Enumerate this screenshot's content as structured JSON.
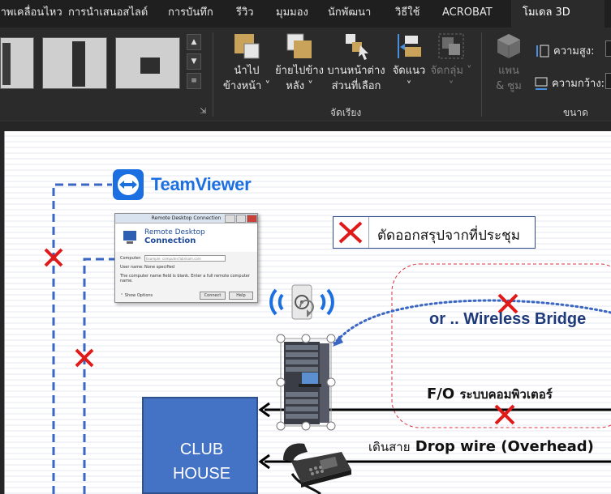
{
  "ribbon": {
    "tabs": [
      {
        "label": "ภาพเคลื่อนไหว",
        "active": false
      },
      {
        "label": "การนำเสนอสไลด์",
        "active": false
      },
      {
        "label": "การบันทึก",
        "active": false
      },
      {
        "label": "รีวิว",
        "active": false
      },
      {
        "label": "มุมมอง",
        "active": false
      },
      {
        "label": "นักพัฒนา",
        "active": false
      },
      {
        "label": "วิธีใช้",
        "active": false
      },
      {
        "label": "ACROBAT",
        "active": false
      },
      {
        "label": "โมเดล 3D",
        "active": true
      }
    ],
    "arrange": {
      "bring_forward": {
        "line1": "นำไป",
        "line2": "ข้างหน้า"
      },
      "send_backward": {
        "line1": "ย้ายไปข้าง",
        "line2": "หลัง"
      },
      "selection_pane": {
        "line1": "บานหน้าต่าง",
        "line2": "ส่วนที่เลือก"
      },
      "align": {
        "line1": "จัดแนว"
      },
      "group": {
        "line1": "จัดกลุ่ม"
      },
      "group_label": "จัดเรียง"
    },
    "size": {
      "pan_zoom": {
        "line1": "แพน",
        "line2": "& ซูม"
      },
      "height_label": "ความสูง:",
      "width_label": "ความกว้าง:",
      "group_label": "ขนาด"
    }
  },
  "slide": {
    "teamviewer_label": "TeamViewer",
    "rdc": {
      "title": "Remote Desktop Connection",
      "header_line1": "Remote Desktop",
      "header_line2": "Connection",
      "computer_label": "Computer:",
      "computer_placeholder": "Example: computer.fabrikam.com",
      "username_label": "User name:",
      "username_value": "None specified",
      "note": "The computer name field is blank. Enter a full remote computer name.",
      "show_options": "Show Options",
      "connect": "Connect",
      "help": "Help"
    },
    "legend_text": "ตัดออกสรุปจากที่ประชุม",
    "wireless_label": "or .. Wireless Bridge",
    "fo_label_bold": "F/O",
    "fo_label_thai": "ระบบคอมพิวเตอร์",
    "dropwire_thai": "เดินสาย",
    "dropwire_label": "Drop wire (Overhead)",
    "club_line1": "CLUB",
    "club_line2": "HOUSE"
  },
  "colors": {
    "accent_blue": "#4472c4",
    "dashed_line": "#3a66c4",
    "cross_red": "#e01919",
    "teamviewer_blue": "#1b6fe0",
    "dash_red": "#d9333f"
  }
}
